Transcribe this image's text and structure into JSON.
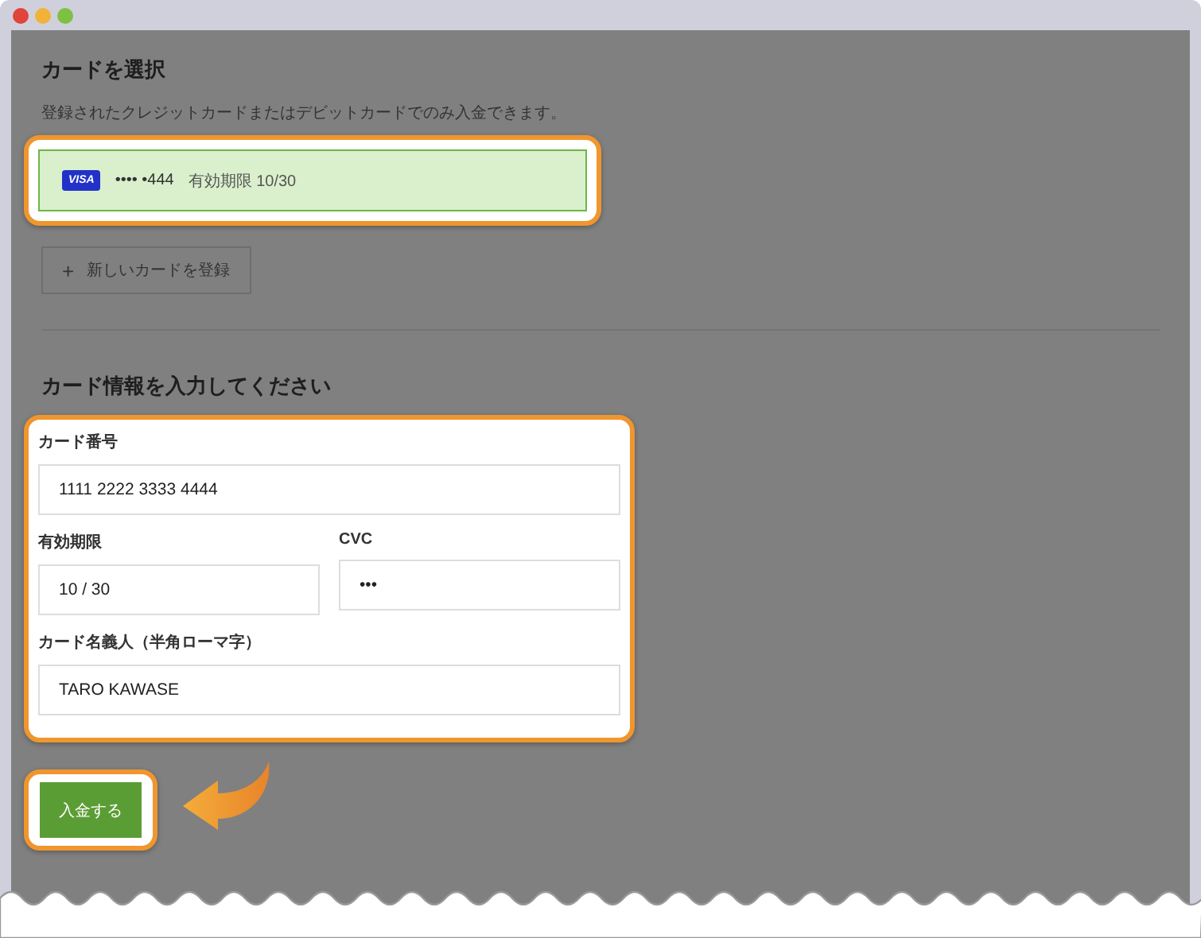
{
  "window": {
    "controls": [
      {
        "color": "#e0443a"
      },
      {
        "color": "#f2b23a"
      },
      {
        "color": "#7cc142"
      }
    ]
  },
  "card_select": {
    "title": "カードを選択",
    "description": "登録されたクレジットカードまたはデビットカードでのみ入金できます。",
    "saved_cards": [
      {
        "brand": "VISA",
        "number": "•••• •444",
        "expiry": "有効期限 10/30",
        "selected": true,
        "highlighted": true
      }
    ],
    "add_button": {
      "icon": "+",
      "label": "新しいカードを登録"
    }
  },
  "card_form": {
    "title": "カード情報を入力してください",
    "highlighted": true,
    "fields": [
      {
        "label": "カード番号",
        "value": "1111 2222 3333 4444",
        "half": false
      },
      {
        "label": "有効期限",
        "value": "10 / 30",
        "half": true
      },
      {
        "label": "CVC",
        "value": "•••",
        "half": true
      },
      {
        "label": "カード名義人（半角ローマ字）",
        "value": "TARO KAWASE",
        "half": false
      }
    ]
  },
  "submit_button": {
    "label": "入金する",
    "highlighted": true,
    "pointer_arrow": true
  }
}
